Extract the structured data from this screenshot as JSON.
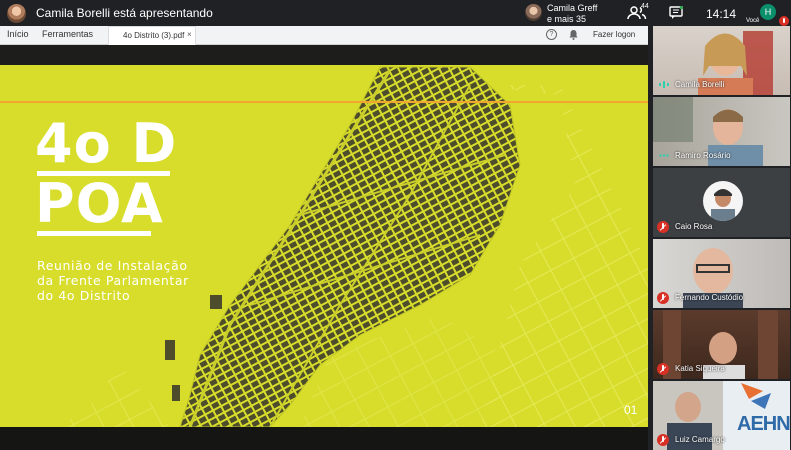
{
  "topbar": {
    "presenting_text": "Camila Borelli está apresentando",
    "others_line1": "Camila Greff",
    "others_line2": "e mais 35",
    "people_count": "44",
    "time": "14:14",
    "self_initial": "H",
    "self_label": "Você"
  },
  "browser": {
    "nav_home": "Início",
    "nav_tools": "Ferramentas",
    "tab_label": "4o Distrito (3).pdf",
    "tab_close": "×",
    "help": "?",
    "logon": "Fazer logon"
  },
  "slide": {
    "title_line1": "4o D",
    "title_line2": "POA",
    "subtitle_line1": "Reunião de Instalação",
    "subtitle_line2": "da Frente Parlamentar",
    "subtitle_line3": "do 4o Distrito",
    "page_number": "01",
    "colors": {
      "background": "#d8dd2c",
      "accent_line": "#f2a630",
      "map_blocks": "#4a4a2e"
    }
  },
  "participants": [
    {
      "name": "Camila Borelli",
      "status": "speaking"
    },
    {
      "name": "Ramiro Rosário",
      "status": "active"
    },
    {
      "name": "Caio Rosa",
      "status": "muted"
    },
    {
      "name": "Fernando Custódio",
      "status": "muted"
    },
    {
      "name": "Katia Siqueira",
      "status": "muted"
    },
    {
      "name": "Luiz Camargo",
      "status": "muted"
    }
  ],
  "tile_logo_text": "AEHN"
}
